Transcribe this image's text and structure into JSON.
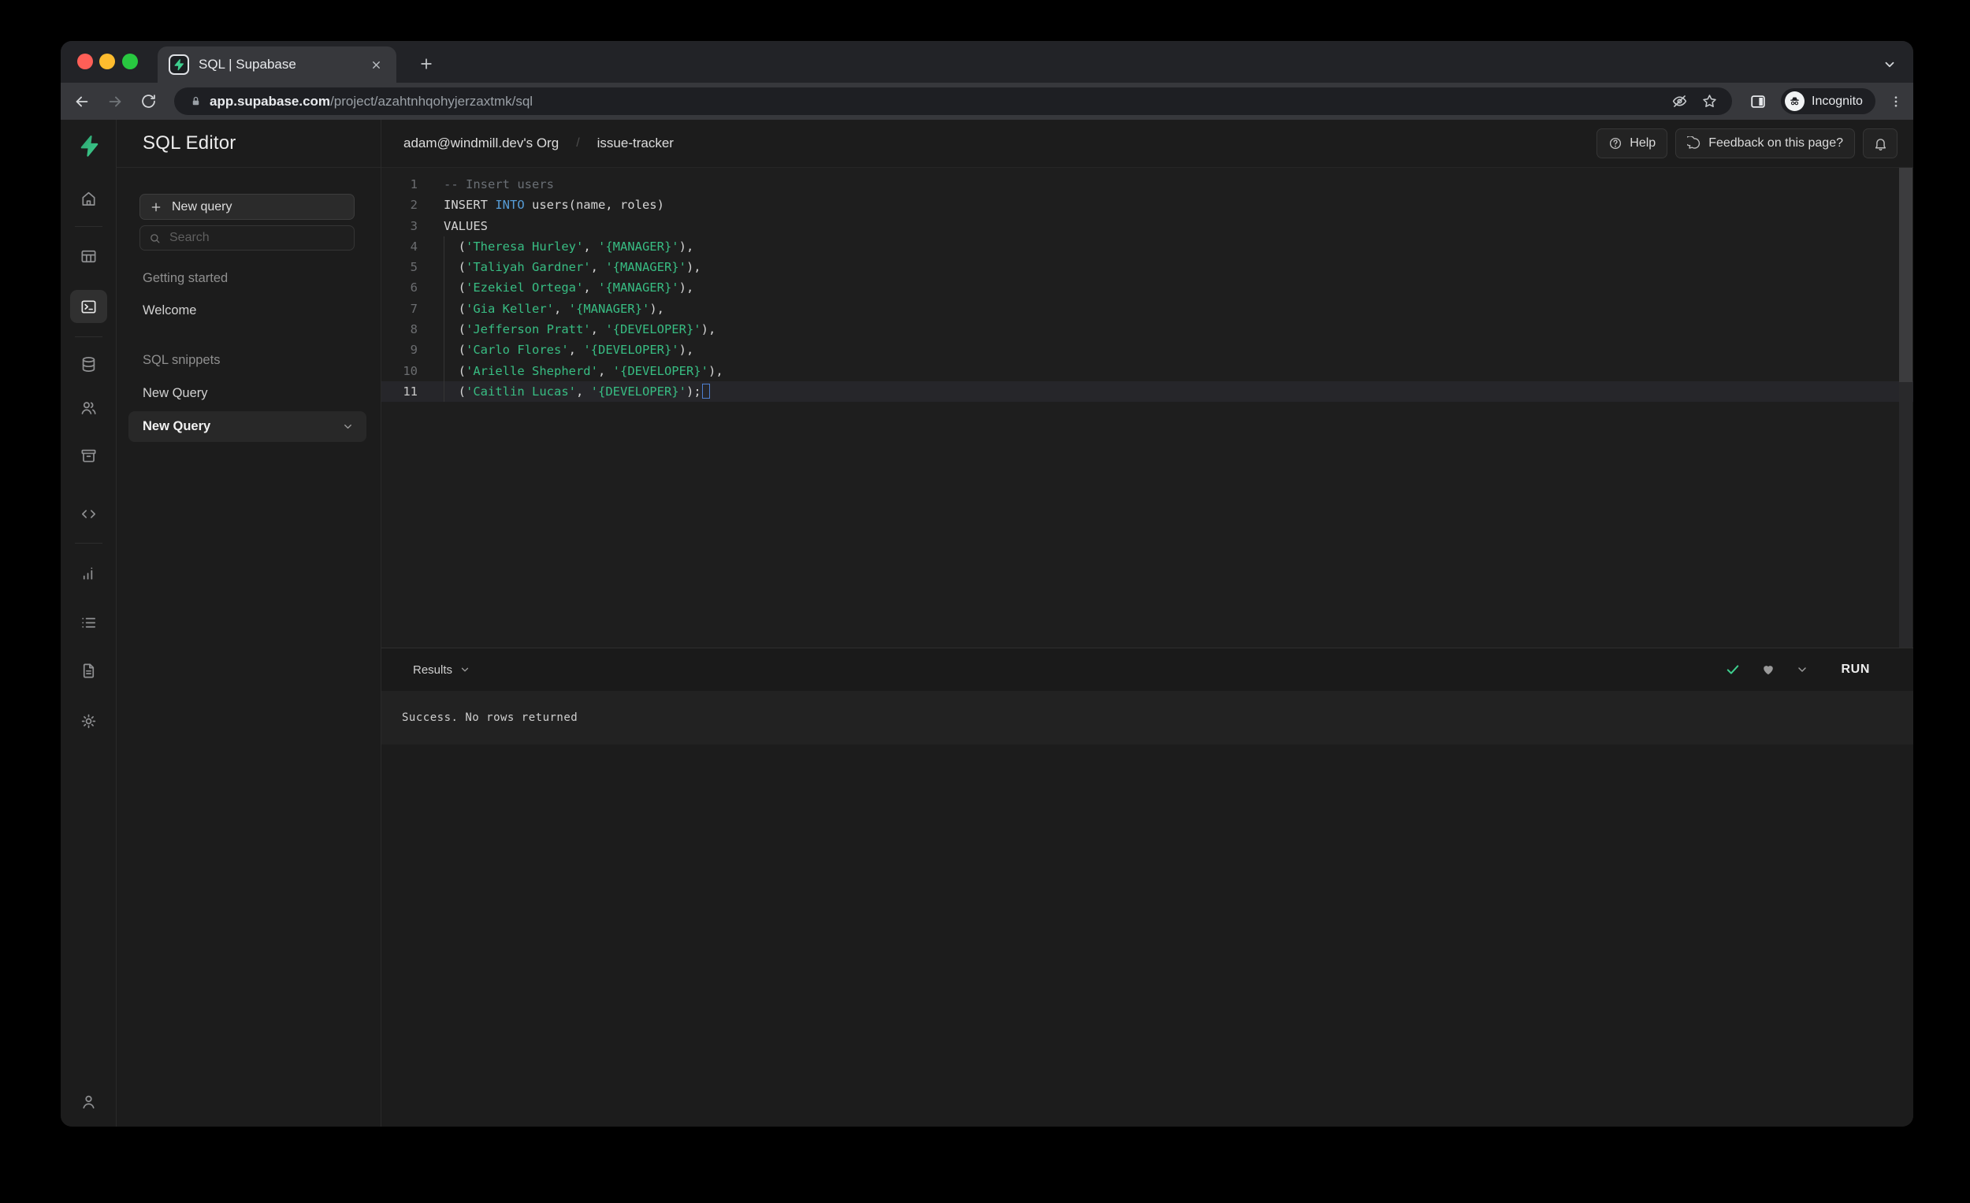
{
  "colors": {
    "brand_green": "#3ecf8e",
    "keyword_blue": "#569cd6",
    "string_green": "#38bd83",
    "window_bg": "#1c1c1c",
    "chrome_toolbar": "#37383c"
  },
  "browser": {
    "tab_title": "SQL | Supabase",
    "url_host": "app.supabase.com",
    "url_path": "/project/azahtnhqohyjerzaxtmk/sql",
    "incognito_label": "Incognito"
  },
  "rail": {
    "items": [
      {
        "icon": "home",
        "selected": false
      },
      {
        "icon": "divider"
      },
      {
        "icon": "table-editor",
        "selected": false
      },
      {
        "icon": "sql-editor",
        "selected": true
      },
      {
        "icon": "divider"
      },
      {
        "icon": "database",
        "selected": false
      },
      {
        "icon": "authentication",
        "selected": false
      },
      {
        "icon": "storage",
        "selected": false
      },
      {
        "icon": "edge-functions",
        "selected": false
      },
      {
        "icon": "divider"
      },
      {
        "icon": "reports",
        "selected": false
      },
      {
        "icon": "logs",
        "selected": false
      },
      {
        "icon": "docs",
        "selected": false
      },
      {
        "icon": "settings",
        "selected": false
      }
    ],
    "bottom_icon": "account"
  },
  "nav": {
    "title": "SQL Editor",
    "new_query_button": "New query",
    "search_placeholder": "Search",
    "sections": [
      {
        "header": "Getting started",
        "items": [
          {
            "label": "Welcome",
            "selected": false
          }
        ]
      },
      {
        "header": "SQL snippets",
        "items": [
          {
            "label": "New Query",
            "selected": false
          },
          {
            "label": "New Query",
            "selected": true
          }
        ]
      }
    ]
  },
  "header": {
    "breadcrumb_org": "adam@windmill.dev's Org",
    "breadcrumb_sep": "/",
    "breadcrumb_project": "issue-tracker",
    "help_label": "Help",
    "feedback_label": "Feedback on this page?"
  },
  "editor": {
    "lines": [
      {
        "num": "1",
        "guide": false,
        "active": false,
        "tokens": [
          {
            "t": "-- Insert users",
            "c": "comment"
          }
        ]
      },
      {
        "num": "2",
        "guide": false,
        "active": false,
        "tokens": [
          {
            "t": "INSERT ",
            "c": "plain"
          },
          {
            "t": "INTO",
            "c": "keyword"
          },
          {
            "t": " users(name, roles)",
            "c": "plain"
          }
        ]
      },
      {
        "num": "3",
        "guide": false,
        "active": false,
        "tokens": [
          {
            "t": "VALUES",
            "c": "plain"
          }
        ]
      },
      {
        "num": "4",
        "guide": true,
        "active": false,
        "tokens": [
          {
            "t": "  (",
            "c": "plain"
          },
          {
            "t": "'Theresa Hurley'",
            "c": "string"
          },
          {
            "t": ", ",
            "c": "plain"
          },
          {
            "t": "'{MANAGER}'",
            "c": "string"
          },
          {
            "t": "),",
            "c": "plain"
          }
        ]
      },
      {
        "num": "5",
        "guide": true,
        "active": false,
        "tokens": [
          {
            "t": "  (",
            "c": "plain"
          },
          {
            "t": "'Taliyah Gardner'",
            "c": "string"
          },
          {
            "t": ", ",
            "c": "plain"
          },
          {
            "t": "'{MANAGER}'",
            "c": "string"
          },
          {
            "t": "),",
            "c": "plain"
          }
        ]
      },
      {
        "num": "6",
        "guide": true,
        "active": false,
        "tokens": [
          {
            "t": "  (",
            "c": "plain"
          },
          {
            "t": "'Ezekiel Ortega'",
            "c": "string"
          },
          {
            "t": ", ",
            "c": "plain"
          },
          {
            "t": "'{MANAGER}'",
            "c": "string"
          },
          {
            "t": "),",
            "c": "plain"
          }
        ]
      },
      {
        "num": "7",
        "guide": true,
        "active": false,
        "tokens": [
          {
            "t": "  (",
            "c": "plain"
          },
          {
            "t": "'Gia Keller'",
            "c": "string"
          },
          {
            "t": ", ",
            "c": "plain"
          },
          {
            "t": "'{MANAGER}'",
            "c": "string"
          },
          {
            "t": "),",
            "c": "plain"
          }
        ]
      },
      {
        "num": "8",
        "guide": true,
        "active": false,
        "tokens": [
          {
            "t": "  (",
            "c": "plain"
          },
          {
            "t": "'Jefferson Pratt'",
            "c": "string"
          },
          {
            "t": ", ",
            "c": "plain"
          },
          {
            "t": "'{DEVELOPER}'",
            "c": "string"
          },
          {
            "t": "),",
            "c": "plain"
          }
        ]
      },
      {
        "num": "9",
        "guide": true,
        "active": false,
        "tokens": [
          {
            "t": "  (",
            "c": "plain"
          },
          {
            "t": "'Carlo Flores'",
            "c": "string"
          },
          {
            "t": ", ",
            "c": "plain"
          },
          {
            "t": "'{DEVELOPER}'",
            "c": "string"
          },
          {
            "t": "),",
            "c": "plain"
          }
        ]
      },
      {
        "num": "10",
        "guide": true,
        "active": false,
        "tokens": [
          {
            "t": "  (",
            "c": "plain"
          },
          {
            "t": "'Arielle Shepherd'",
            "c": "string"
          },
          {
            "t": ", ",
            "c": "plain"
          },
          {
            "t": "'{DEVELOPER}'",
            "c": "string"
          },
          {
            "t": "),",
            "c": "plain"
          }
        ]
      },
      {
        "num": "11",
        "guide": true,
        "active": true,
        "tokens": [
          {
            "t": "  (",
            "c": "plain"
          },
          {
            "t": "'Caitlin Lucas'",
            "c": "string"
          },
          {
            "t": ", ",
            "c": "plain"
          },
          {
            "t": "'{DEVELOPER}'",
            "c": "string"
          },
          {
            "t": ");",
            "c": "plain"
          }
        ]
      }
    ]
  },
  "results": {
    "label": "Results",
    "run_label": "RUN",
    "message": "Success. No rows returned"
  }
}
